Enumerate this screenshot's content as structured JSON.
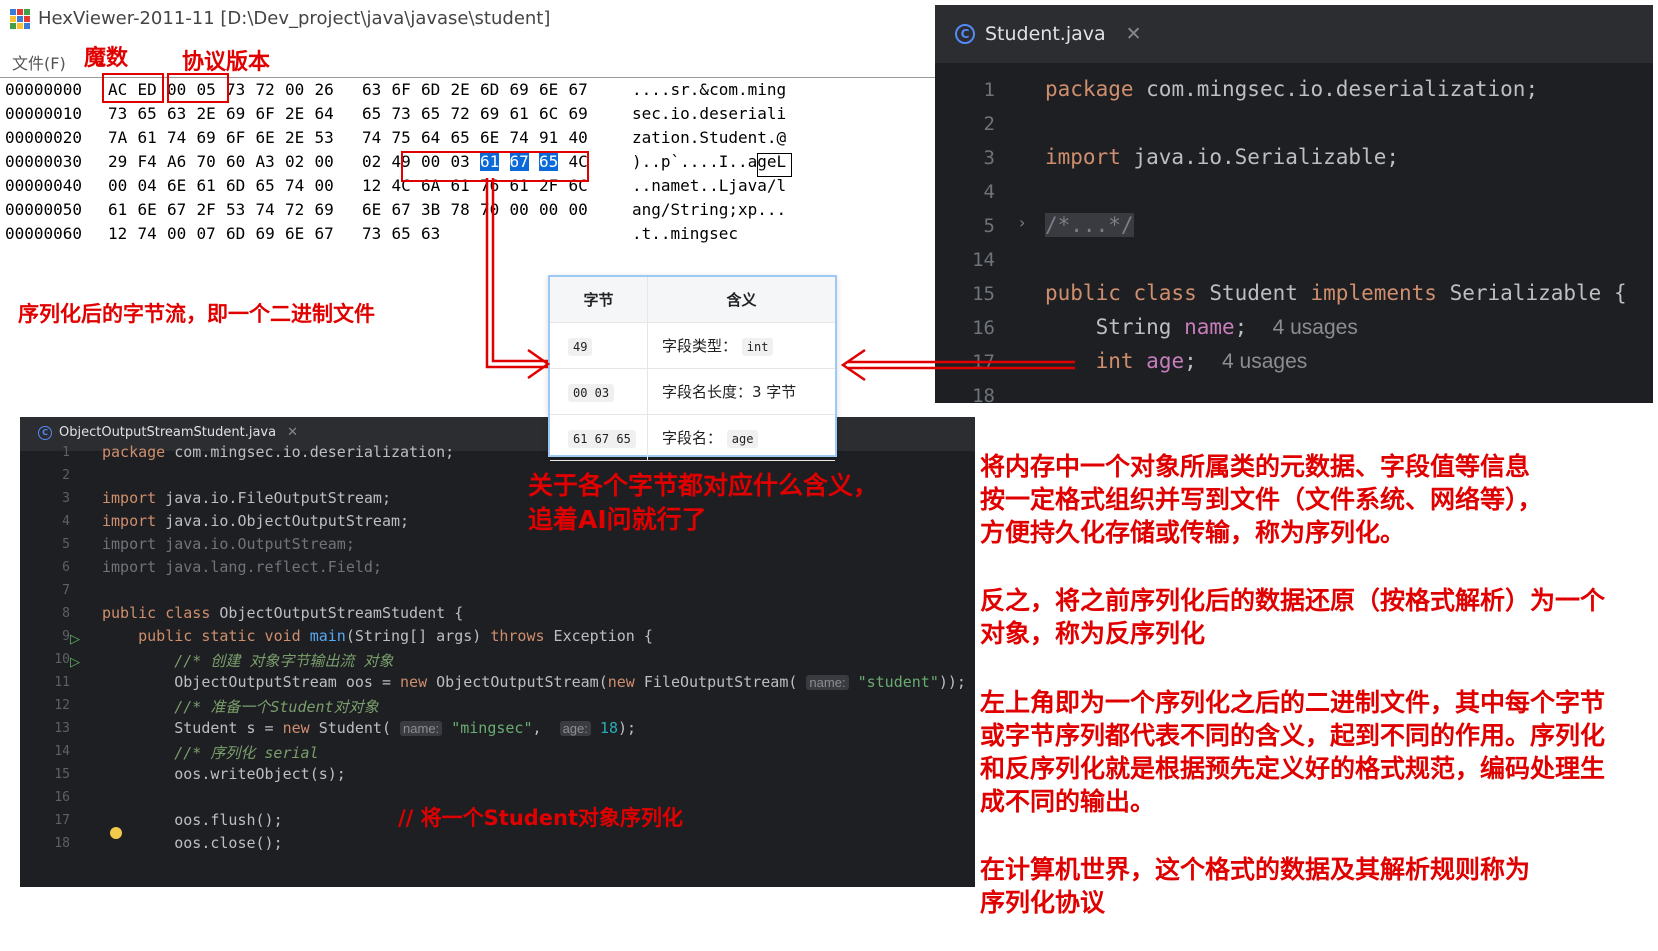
{
  "hex_viewer": {
    "title": "HexViewer-2011-11 [D:\\Dev_project\\java\\javase\\student]",
    "menu_file": "文件(F)",
    "rows": [
      {
        "offset": "00000000",
        "bytes": [
          "AC",
          "ED",
          "00",
          "05",
          "73",
          "72",
          "00",
          "26",
          "63",
          "6F",
          "6D",
          "2E",
          "6D",
          "69",
          "6E",
          "67"
        ],
        "ascii": "....sr.&com.ming"
      },
      {
        "offset": "00000010",
        "bytes": [
          "73",
          "65",
          "63",
          "2E",
          "69",
          "6F",
          "2E",
          "64",
          "65",
          "73",
          "65",
          "72",
          "69",
          "61",
          "6C",
          "69"
        ],
        "ascii": "sec.io.deseriali"
      },
      {
        "offset": "00000020",
        "bytes": [
          "7A",
          "61",
          "74",
          "69",
          "6F",
          "6E",
          "2E",
          "53",
          "74",
          "75",
          "64",
          "65",
          "6E",
          "74",
          "91",
          "40"
        ],
        "ascii": "zation.Student.@"
      },
      {
        "offset": "00000030",
        "bytes": [
          "29",
          "F4",
          "A6",
          "70",
          "60",
          "A3",
          "02",
          "00",
          "02",
          "49",
          "00",
          "03",
          "61",
          "67",
          "65",
          "4C"
        ],
        "ascii": ")..p`....I..ageL"
      },
      {
        "offset": "00000040",
        "bytes": [
          "00",
          "04",
          "6E",
          "61",
          "6D",
          "65",
          "74",
          "00",
          "12",
          "4C",
          "6A",
          "61",
          "76",
          "61",
          "2F",
          "6C"
        ],
        "ascii": "..namet..Ljava/l"
      },
      {
        "offset": "00000050",
        "bytes": [
          "61",
          "6E",
          "67",
          "2F",
          "53",
          "74",
          "72",
          "69",
          "6E",
          "67",
          "3B",
          "78",
          "70",
          "00",
          "00",
          "00"
        ],
        "ascii": "ang/String;xp..."
      },
      {
        "offset": "00000060",
        "bytes": [
          "12",
          "74",
          "00",
          "07",
          "6D",
          "69",
          "6E",
          "67",
          "73",
          "65",
          "63"
        ],
        "ascii": ".t..mingsec"
      }
    ]
  },
  "annotations": {
    "magic": "魔数",
    "protocol_version": "协议版本",
    "byte_stream": "序列化后的字节流，即一个二进制文件",
    "ask_ai_line1": "关于各个字节都对应什么含义，",
    "ask_ai_line2": "追着AI问就行了",
    "serialize_comment": "// 将一个Student对象序列化"
  },
  "byte_table": {
    "headers": [
      "字节",
      "含义"
    ],
    "rows": [
      {
        "bytes": "49",
        "meaning": "字段类型：",
        "value": "int"
      },
      {
        "bytes": "00 03",
        "meaning": "字段名长度：3 字节",
        "value": ""
      },
      {
        "bytes": "61 67 65",
        "meaning": "字段名：",
        "value": "age"
      }
    ]
  },
  "student_editor": {
    "tab": "Student.java",
    "lines": [
      {
        "n": "1",
        "text": "package com.mingsec.io.deserialization;"
      },
      {
        "n": "2",
        "text": ""
      },
      {
        "n": "3",
        "text": "import java.io.Serializable;"
      },
      {
        "n": "4",
        "text": ""
      },
      {
        "n": "5",
        "text": "/*...*/"
      },
      {
        "n": "14",
        "text": ""
      },
      {
        "n": "15",
        "text": "public class Student implements Serializable {"
      },
      {
        "n": "16",
        "text": "String name;"
      },
      {
        "n": "17",
        "text": "int age;"
      },
      {
        "n": "18",
        "text": ""
      }
    ],
    "usages": "4 usages"
  },
  "oos_editor": {
    "tab": "ObjectOutputStreamStudent.java",
    "lines": [
      {
        "n": "1",
        "text": "package com.mingsec.io.deserialization;"
      },
      {
        "n": "2",
        "text": ""
      },
      {
        "n": "3",
        "text": "import java.io.FileOutputStream;"
      },
      {
        "n": "4",
        "text": "import java.io.ObjectOutputStream;"
      },
      {
        "n": "5",
        "text": "import java.io.OutputStream;"
      },
      {
        "n": "6",
        "text": "import java.lang.reflect.Field;"
      },
      {
        "n": "7",
        "text": ""
      },
      {
        "n": "8",
        "text": "public class ObjectOutputStreamStudent {"
      },
      {
        "n": "9",
        "text": "public static void main(String[] args) throws Exception {"
      },
      {
        "n": "10",
        "text": "//* 创建 对象字节输出流 对象"
      },
      {
        "n": "11",
        "text": "ObjectOutputStream oos = new ObjectOutputStream(new FileOutputStream( name: \"student\"));"
      },
      {
        "n": "12",
        "text": "//* 准备一个Student对对象"
      },
      {
        "n": "13",
        "text": "Student s = new Student( name: \"mingsec\",  age: 18);"
      },
      {
        "n": "14",
        "text": "//* 序列化 serial"
      },
      {
        "n": "15",
        "text": "oos.writeObject(s);"
      },
      {
        "n": "16",
        "text": ""
      },
      {
        "n": "17",
        "text": "oos.flush();"
      },
      {
        "n": "18",
        "text": "oos.close();"
      }
    ]
  },
  "explanation": {
    "p1": [
      "将内存中一个对象所属类的元数据、字段值等信息",
      "按一定格式组织并写到文件（文件系统、网络等），",
      "方便持久化存储或传输，称为序列化。"
    ],
    "p2": [
      "反之，将之前序列化后的数据还原（按格式解析）为一个",
      "对象，称为反序列化"
    ],
    "p3": [
      "左上角即为一个序列化之后的二进制文件，其中每个字节",
      "或字节序列都代表不同的含义，起到不同的作用。序列化",
      "和反序列化就是根据预先定义好的格式规范，编码处理生",
      "成不同的输出。"
    ],
    "p4": [
      "在计算机世界，这个格式的数据及其解析规则称为",
      "序列化协议"
    ]
  },
  "colors": {
    "annotation_red": "#e00000",
    "hex_highlight": "#0a6ad9",
    "ide_bg": "#1e1f22"
  }
}
